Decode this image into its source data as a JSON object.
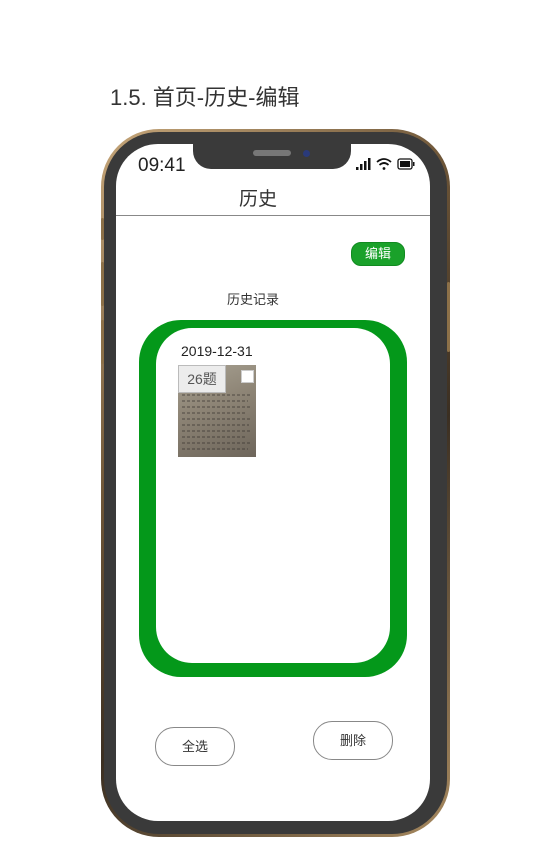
{
  "page": {
    "title": "1.5. 首页-历史-编辑"
  },
  "status_bar": {
    "time": "09:41",
    "icons": [
      "signal-icon",
      "wifi-icon",
      "battery-icon"
    ]
  },
  "nav": {
    "title": "历史"
  },
  "toolbar": {
    "edit_label": "编辑"
  },
  "history": {
    "section_label": "历史记录",
    "items": [
      {
        "date": "2019-12-31",
        "count": "26题",
        "selected": false
      }
    ]
  },
  "actions": {
    "select_all_label": "全选",
    "delete_label": "删除"
  },
  "colors": {
    "accent": "#1aa12a",
    "card_frame": "#04981a"
  }
}
